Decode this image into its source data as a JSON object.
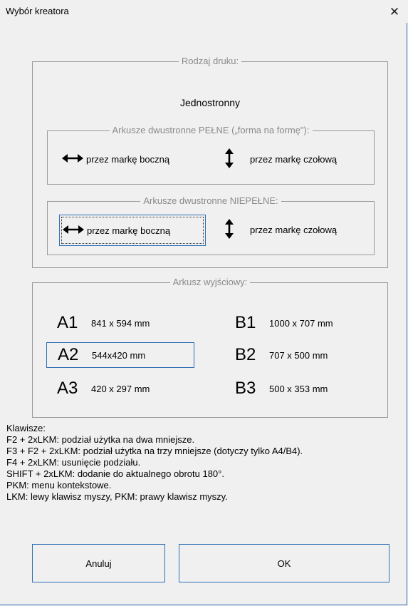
{
  "window": {
    "title": "Wybór kreatora",
    "close_glyph": "✕"
  },
  "print_type": {
    "legend": "Rodzaj druku:",
    "single_sided": "Jednostronny",
    "full": {
      "legend": "Arkusze dwustronne PEŁNE („forma na formę\"):",
      "side": "przez markę boczną",
      "head": "przez markę czołową"
    },
    "partial": {
      "legend": "Arkusze dwustronne NIEPEŁNE:",
      "side": "przez markę boczną",
      "head": "przez markę czołową",
      "selected": "side"
    }
  },
  "output_sheet": {
    "legend": "Arkusz wyjściowy:",
    "sizes": [
      {
        "name": "A1",
        "dim": "841 x 594 mm"
      },
      {
        "name": "B1",
        "dim": "1000 x 707 mm"
      },
      {
        "name": "A2",
        "dim": "544x420 mm"
      },
      {
        "name": "B2",
        "dim": "707 x 500 mm"
      },
      {
        "name": "A3",
        "dim": "420 x 297 mm"
      },
      {
        "name": "B3",
        "dim": "500 x 353 mm"
      }
    ],
    "selected": "A2"
  },
  "keys": [
    "Klawisze:",
    "F2 + 2xLKM: podział użytka na dwa mniejsze.",
    "F3 + F2 + 2xLKM: podział użytka na trzy mniejsze (dotyczy tylko A4/B4).",
    "F4 + 2xLKM: usunięcie podziału.",
    "SHIFT + 2xLKM: dodanie do aktualnego obrotu 180°.",
    "PKM: menu kontekstowe.",
    "LKM: lewy klawisz myszy, PKM: prawy klawisz myszy."
  ],
  "buttons": {
    "cancel": "Anuluj",
    "ok": "OK"
  },
  "icons": {
    "horizontal": "left-right-arrow-icon",
    "vertical": "up-down-arrow-icon"
  },
  "colors": {
    "accent": "#2f6fb5",
    "legend_text": "#8a8a8a",
    "border": "#9a9a9a",
    "background": "#f0f0f0"
  }
}
